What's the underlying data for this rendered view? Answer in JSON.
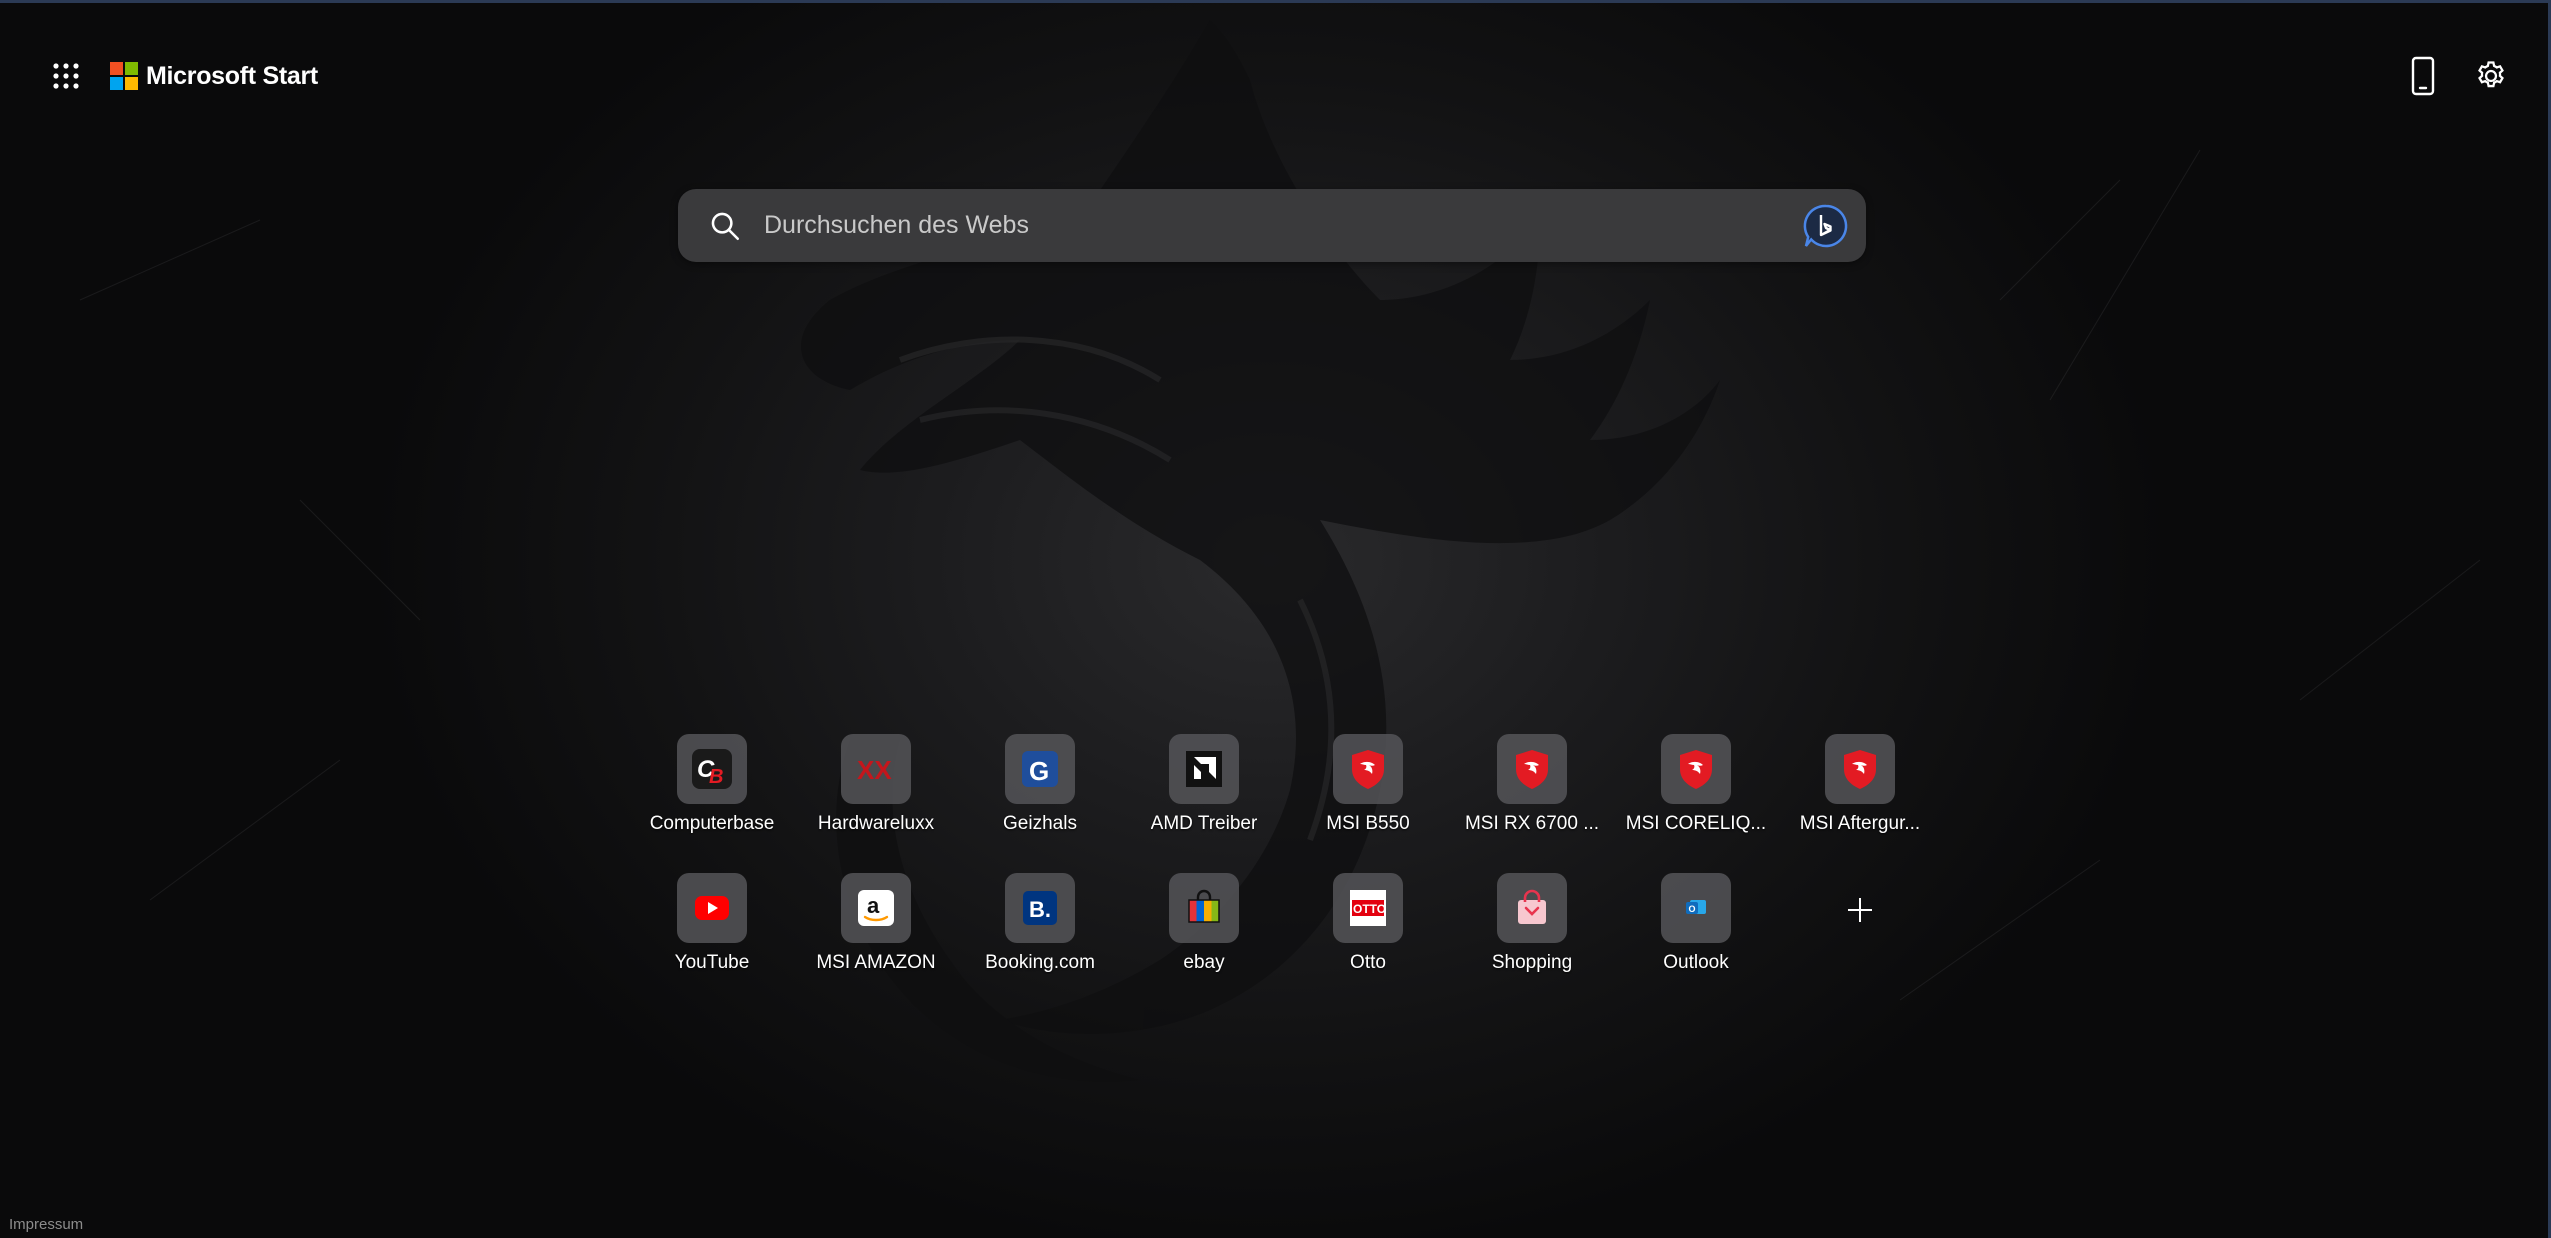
{
  "header": {
    "brand": "Microsoft Start",
    "apps_icon": "app-launcher-grid-icon",
    "mobile_icon": "mobile-phone-icon",
    "settings_icon": "gear-icon"
  },
  "colors": {
    "logo_red": "#f25022",
    "logo_green": "#7fba00",
    "logo_blue": "#00a4ef",
    "logo_yellow": "#ffb900",
    "search_bg": "#3a3a3c",
    "msi_red": "#e31b23"
  },
  "search": {
    "placeholder": "Durchsuchen des Webs",
    "icon": "search-icon",
    "bing_icon": "bing-chat-icon"
  },
  "quick_links": [
    {
      "label": "Computerbase",
      "icon": "computerbase-icon"
    },
    {
      "label": "Hardwareluxx",
      "icon": "hardwareluxx-icon"
    },
    {
      "label": "Geizhals",
      "icon": "geizhals-icon"
    },
    {
      "label": "AMD Treiber",
      "icon": "amd-icon"
    },
    {
      "label": "MSI B550",
      "icon": "msi-dragon-icon"
    },
    {
      "label": "MSI RX 6700 ...",
      "icon": "msi-dragon-icon"
    },
    {
      "label": "MSI CORELIQ...",
      "icon": "msi-dragon-icon"
    },
    {
      "label": "MSI Aftergur...",
      "icon": "msi-dragon-icon"
    },
    {
      "label": "YouTube",
      "icon": "youtube-icon"
    },
    {
      "label": "MSI AMAZON",
      "icon": "amazon-icon"
    },
    {
      "label": "Booking.com",
      "icon": "booking-icon"
    },
    {
      "label": "ebay",
      "icon": "ebay-bag-icon"
    },
    {
      "label": "Otto",
      "icon": "otto-icon"
    },
    {
      "label": "Shopping",
      "icon": "shopping-bag-icon"
    },
    {
      "label": "Outlook",
      "icon": "outlook-icon"
    }
  ],
  "add_link_icon": "plus-icon",
  "footer": {
    "impressum": "Impressum"
  }
}
